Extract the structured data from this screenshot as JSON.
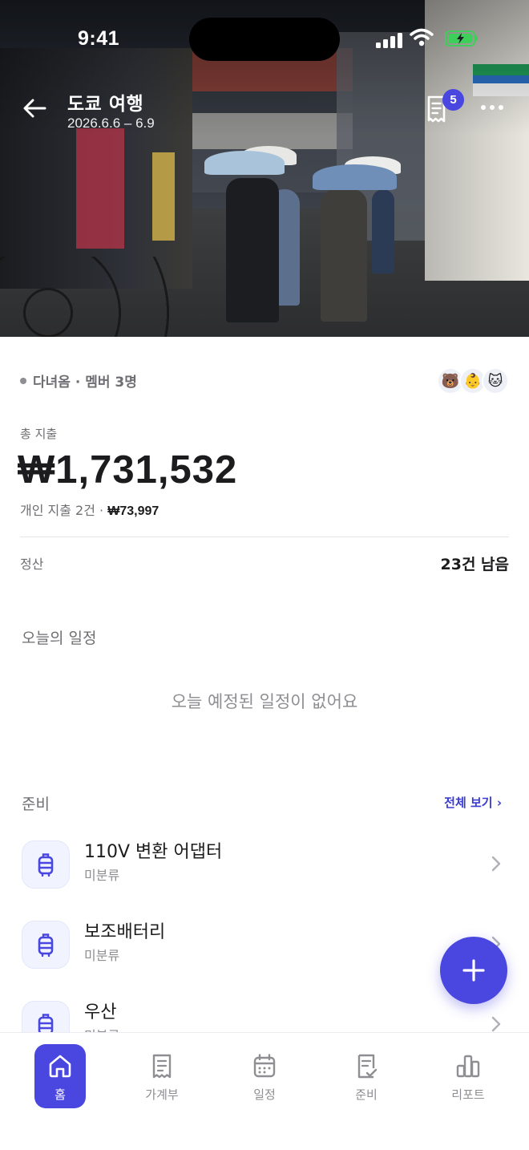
{
  "status_bar": {
    "time": "9:41"
  },
  "header": {
    "title": "도쿄 여행",
    "dates": "2026.6.6 – 6.9",
    "receipt_badge": "5",
    "back_icon": "arrow-left-icon",
    "receipt_icon": "receipt-icon",
    "more_icon": "more-icon"
  },
  "trip": {
    "status": "다녀옴 · 멤버 3명",
    "members": [
      "🐻",
      "👶",
      "🐱"
    ]
  },
  "expense": {
    "total_label": "총 지출",
    "total_amount": "₩1,731,532",
    "personal_prefix": "개인 지출 2건 · ",
    "personal_amount": "₩73,997"
  },
  "settlement": {
    "label": "정산",
    "remaining": "23건 남음"
  },
  "today": {
    "label": "오늘의 일정",
    "empty_message": "오늘 예정된 일정이 없어요"
  },
  "prep": {
    "label": "준비",
    "view_all": "전체 보기 ›",
    "items": [
      {
        "name": "110V 변환 어댑터",
        "category": "미분류"
      },
      {
        "name": "보조배터리",
        "category": "미분류"
      },
      {
        "name": "우산",
        "category": "미분류"
      }
    ]
  },
  "fab": {
    "icon": "plus-icon"
  },
  "nav": {
    "items": [
      {
        "label": "홈",
        "icon": "home-icon"
      },
      {
        "label": "가계부",
        "icon": "receipt-icon"
      },
      {
        "label": "일정",
        "icon": "calendar-icon"
      },
      {
        "label": "준비",
        "icon": "checklist-icon"
      },
      {
        "label": "리포트",
        "icon": "chart-icon"
      }
    ]
  },
  "colors": {
    "accent": "#4a46e0",
    "link": "#3b3bd1",
    "muted": "#8e8e93"
  }
}
